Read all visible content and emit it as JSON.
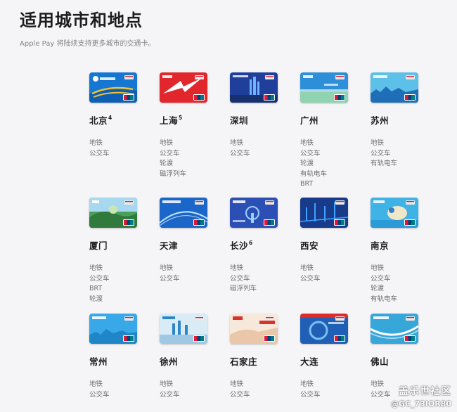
{
  "title": "适用城市和地点",
  "subtitle": "Apple Pay 将陆续支持更多城市的交通卡。",
  "cities": [
    {
      "name": "北京",
      "sup": "4",
      "modes": [
        "地铁",
        "公交车"
      ],
      "card": {
        "bg": "#1677d2",
        "accent": "#f1c232",
        "style": "beijing"
      }
    },
    {
      "name": "上海",
      "sup": "5",
      "modes": [
        "地铁",
        "公交车",
        "轮渡",
        "磁浮列车"
      ],
      "card": {
        "bg": "#e1262c",
        "accent": "#ffffff",
        "style": "shanghai"
      }
    },
    {
      "name": "深圳",
      "sup": "",
      "modes": [
        "地铁",
        "公交车"
      ],
      "card": {
        "bg": "#1f3f9a",
        "accent": "#6fb3ff",
        "style": "shenzhen"
      }
    },
    {
      "name": "广州",
      "sup": "",
      "modes": [
        "地铁",
        "公交车",
        "轮渡",
        "有轨电车",
        "BRT"
      ],
      "card": {
        "bg": "#2c8fd8",
        "accent": "#8fd3b0",
        "style": "guangzhou"
      }
    },
    {
      "name": "苏州",
      "sup": "",
      "modes": [
        "地铁",
        "公交车",
        "有轨电车"
      ],
      "card": {
        "bg": "#5cc0e8",
        "accent": "#1e6fb8",
        "style": "suzhou"
      }
    },
    {
      "name": "厦门",
      "sup": "",
      "modes": [
        "地铁",
        "公交车",
        "BRT",
        "轮渡"
      ],
      "card": {
        "bg": "#4aa05a",
        "accent": "#a7d8f0",
        "style": "xiamen"
      }
    },
    {
      "name": "天津",
      "sup": "",
      "modes": [
        "地铁",
        "公交车"
      ],
      "card": {
        "bg": "#1a67c9",
        "accent": "#bfe3ff",
        "style": "tianjin"
      }
    },
    {
      "name": "长沙",
      "sup": "6",
      "modes": [
        "地铁",
        "公交车",
        "磁浮列车"
      ],
      "card": {
        "bg": "#2b4fb4",
        "accent": "#9ad1ff",
        "style": "changsha"
      }
    },
    {
      "name": "西安",
      "sup": "",
      "modes": [
        "地铁",
        "公交车"
      ],
      "card": {
        "bg": "#173a8a",
        "accent": "#3fa2ff",
        "style": "xian"
      }
    },
    {
      "name": "南京",
      "sup": "",
      "modes": [
        "地铁",
        "公交车",
        "轮渡",
        "有轨电车"
      ],
      "card": {
        "bg": "#3fb2e6",
        "accent": "#f0e6c8",
        "style": "nanjing"
      }
    },
    {
      "name": "常州",
      "sup": "",
      "modes": [
        "地铁",
        "公交车"
      ],
      "card": {
        "bg": "#39a8e8",
        "accent": "#ffffff",
        "style": "changzhou"
      }
    },
    {
      "name": "徐州",
      "sup": "",
      "modes": [
        "地铁",
        "公交车"
      ],
      "card": {
        "bg": "#d9ecf6",
        "accent": "#2f86c6",
        "style": "xuzhou"
      }
    },
    {
      "name": "石家庄",
      "sup": "",
      "modes": [
        "地铁",
        "公交车"
      ],
      "card": {
        "bg": "#f6e9dc",
        "accent": "#d8322b",
        "style": "shijiazhuang"
      }
    },
    {
      "name": "大连",
      "sup": "",
      "modes": [
        "地铁",
        "公交车"
      ],
      "card": {
        "bg": "#1f5fb6",
        "accent": "#7cc0f0",
        "style": "dalian"
      }
    },
    {
      "name": "佛山",
      "sup": "",
      "modes": [
        "地铁",
        "公交车"
      ],
      "card": {
        "bg": "#37a6d8",
        "accent": "#ffffff",
        "style": "foshan"
      }
    }
  ],
  "watermark": {
    "site": "盖乐世社区",
    "user": "@GC_73IOR80"
  }
}
